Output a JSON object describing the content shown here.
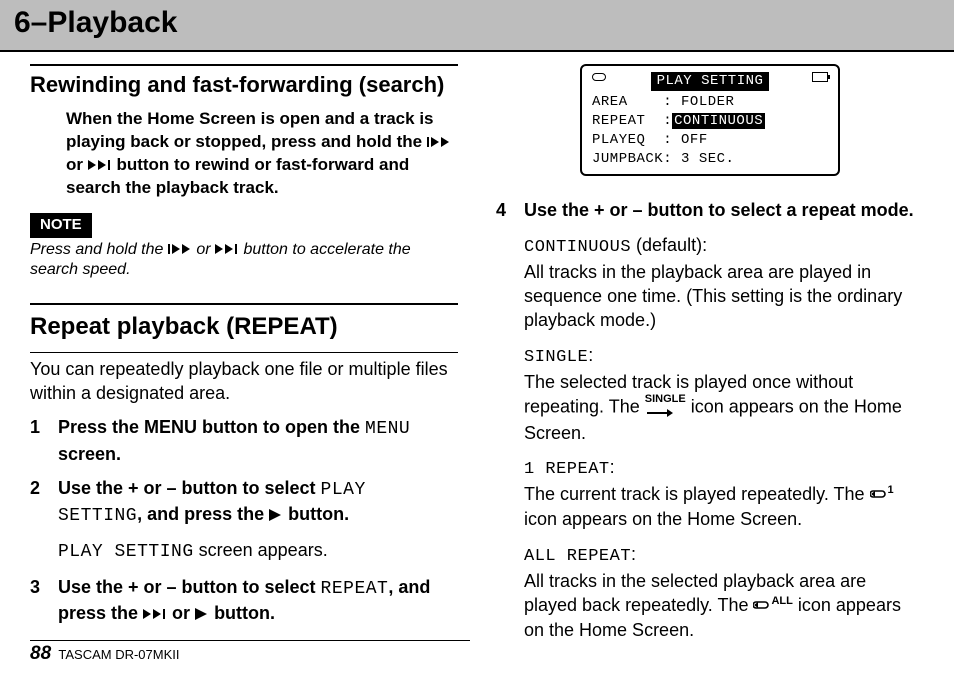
{
  "banner": {
    "title": "6–Playback"
  },
  "left": {
    "section1_head": "Rewinding and fast-forwarding (search)",
    "section1_intro_a": "When the Home Screen is open and a track is playing back or stopped, press and hold the ",
    "section1_intro_b": " or ",
    "section1_intro_c": " button to rewind or fast-forward and search the playback track.",
    "note_tag": "NOTE",
    "note_a": "Press and hold the ",
    "note_b": " or ",
    "note_c": " button to accelerate the search speed.",
    "section2_head": "Repeat playback (REPEAT)",
    "section2_intro": "You can repeatedly playback one file or multiple files within a designated area.",
    "step1_a": "Press the MENU button to open the ",
    "step1_menu": "MENU",
    "step1_b": " screen.",
    "step2_a": "Use the + or – button to select ",
    "step2_ps": "PLAY SETTING",
    "step2_b": ", and press the ",
    "step2_c": " button.",
    "step2_sub_a": "PLAY SETTING",
    "step2_sub_b": " screen appears.",
    "step3_a": "Use the + or – button to select ",
    "step3_rep": "REPEAT",
    "step3_b": ", and press the ",
    "step3_c": " or ",
    "step3_d": " button."
  },
  "screen": {
    "title": "PLAY SETTING",
    "rows": [
      "AREA    : FOLDER",
      "REPEAT  :",
      "PLAYEQ  : OFF",
      "JUMPBACK: 3 SEC."
    ],
    "repeat_value": "CONTINUOUS"
  },
  "right": {
    "step4": "Use the + or – button to select a repeat mode.",
    "continuous_label": "CONTINUOUS",
    "continuous_suffix": " (default):",
    "continuous_desc": "All tracks in the playback area are played in sequence one time. (This setting is the ordinary playback mode.)",
    "single_label": "SINGLE",
    "single_colon": ":",
    "single_desc_a": "The selected track is played once without repeating. The ",
    "single_desc_b": " icon appears on the Home Screen.",
    "one_repeat_label": "1 REPEAT",
    "one_repeat_colon": ":",
    "one_repeat_desc_a": "The current track is played repeatedly. The ",
    "one_repeat_desc_b": " icon appears on the Home Screen.",
    "all_repeat_label": "ALL REPEAT",
    "all_repeat_colon": ":",
    "all_repeat_desc_a": "All tracks in the selected playback area are played back repeatedly. The ",
    "all_repeat_desc_b": " icon appears on the Home Screen."
  },
  "footer": {
    "page": "88",
    "model": "TASCAM DR-07MKII"
  }
}
